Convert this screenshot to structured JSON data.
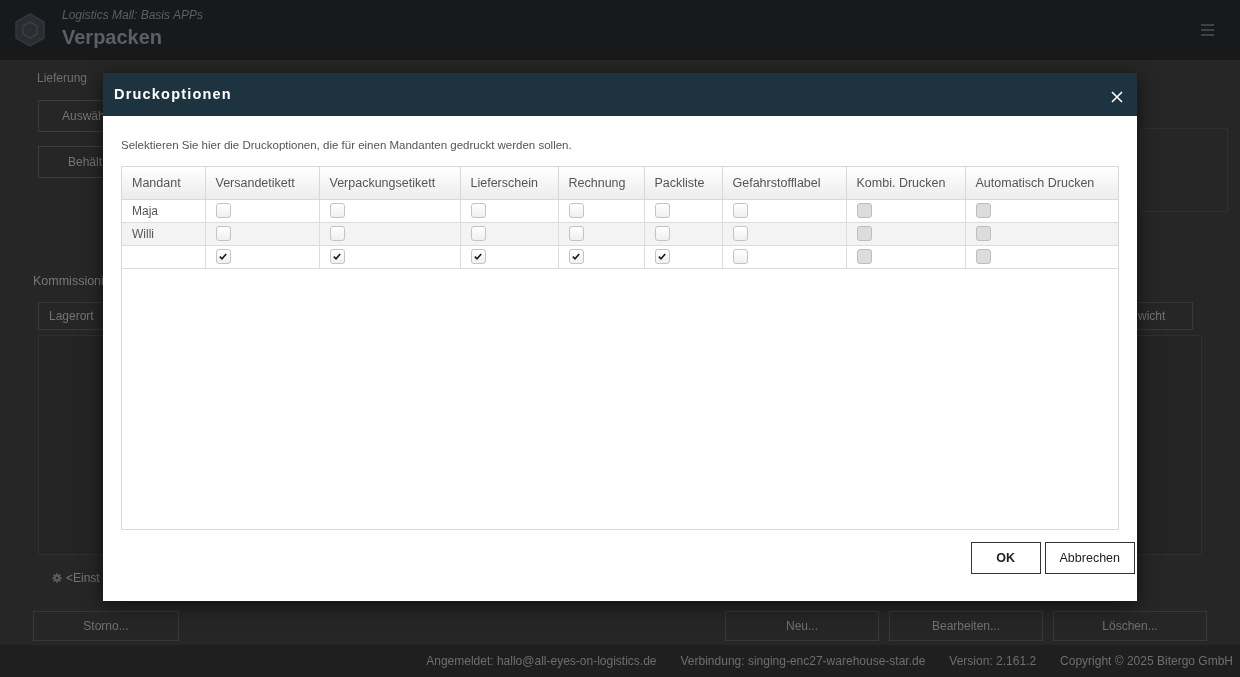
{
  "header": {
    "subtitle": "Logistics Mall: Basis APPs",
    "title": "Verpacken"
  },
  "page": {
    "section_label": "Lieferung",
    "buttons": [
      "Auswäh",
      "Behält"
    ],
    "section_title": "Kommissioni",
    "field_left": "Lagerort",
    "field_right": "wicht",
    "settings_link": "<Einst",
    "actions_left": [
      "Storno..."
    ],
    "actions_right": [
      "Neu...",
      "Bearbeiten...",
      "Löschen..."
    ]
  },
  "status_bar": [
    "Angemeldet: hallo@all-eyes-on-logistics.de",
    "Verbindung: singing-enc27-warehouse-star.de",
    "Version: 2.161.2",
    "Copyright © 2025 Bitergo GmbH"
  ],
  "dialog": {
    "title": "Druckoptionen",
    "description": "Selektieren Sie hier die Druckoptionen, die für einen Mandanten gedruckt werden sollen.",
    "columns": [
      "Mandant",
      "Versandetikett",
      "Verpackungsetikett",
      "Lieferschein",
      "Rechnung",
      "Packliste",
      "Gefahrstofflabel",
      "Kombi. Drucken",
      "Automatisch Drucken"
    ],
    "rows": [
      {
        "mandant": "Maja",
        "options": [
          {
            "checked": false,
            "disabled": false
          },
          {
            "checked": false,
            "disabled": false
          },
          {
            "checked": false,
            "disabled": false
          },
          {
            "checked": false,
            "disabled": false
          },
          {
            "checked": false,
            "disabled": false
          },
          {
            "checked": false,
            "disabled": false
          },
          {
            "checked": false,
            "disabled": true
          },
          {
            "checked": false,
            "disabled": true
          }
        ]
      },
      {
        "mandant": "Willi",
        "options": [
          {
            "checked": false,
            "disabled": false
          },
          {
            "checked": false,
            "disabled": false
          },
          {
            "checked": false,
            "disabled": false
          },
          {
            "checked": false,
            "disabled": false
          },
          {
            "checked": false,
            "disabled": false
          },
          {
            "checked": false,
            "disabled": false
          },
          {
            "checked": false,
            "disabled": true
          },
          {
            "checked": false,
            "disabled": true
          }
        ]
      },
      {
        "options": [
          {
            "checked": true,
            "disabled": false
          },
          {
            "checked": true,
            "disabled": false
          },
          {
            "checked": true,
            "disabled": false
          },
          {
            "checked": true,
            "disabled": false
          },
          {
            "checked": true,
            "disabled": false
          },
          {
            "checked": false,
            "disabled": false
          },
          {
            "checked": false,
            "disabled": true
          },
          {
            "checked": false,
            "disabled": true
          }
        ]
      }
    ],
    "buttons": [
      {
        "label": "OK",
        "kind": "primary"
      },
      {
        "label": "Abbrechen",
        "kind": "secondary"
      }
    ]
  }
}
